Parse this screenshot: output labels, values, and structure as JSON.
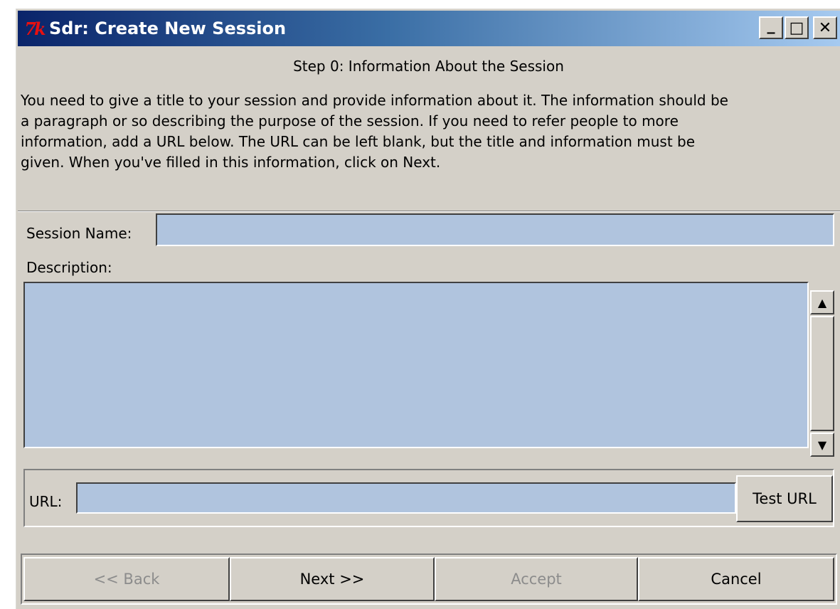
{
  "window": {
    "title": "Sdr: Create New Session",
    "app_icon": "tk-feather-icon",
    "controls": {
      "minimize": "_",
      "maximize": "□",
      "close": "✕"
    }
  },
  "step_heading": "Step 0: Information About the Session",
  "intro_lines": [
    "You need to give a title to your session and provide information about it.  The information should be",
    "a paragraph or so describing the purpose of the session.  If you need to refer people to more",
    "information, add a URL below.  The URL can be left blank, but the title and information must be",
    "given.  When you've filled in this information, click on Next."
  ],
  "form": {
    "session_name_label": "Session Name:",
    "session_name_value": "",
    "description_label": "Description:",
    "description_value": "",
    "url_label": "URL:",
    "url_value": "",
    "test_url_label": "Test URL"
  },
  "scrollbar": {
    "up": "▲",
    "down": "▼"
  },
  "buttons": {
    "back": "<< Back",
    "next": "Next >>",
    "accept": "Accept",
    "cancel": "Cancel"
  },
  "colors": {
    "window_bg": "#d4d0c8",
    "field_bg": "#b0c4de",
    "titlebar_start": "#0a246a",
    "titlebar_end": "#a6caf0",
    "disabled_text": "#8c8c8c"
  }
}
